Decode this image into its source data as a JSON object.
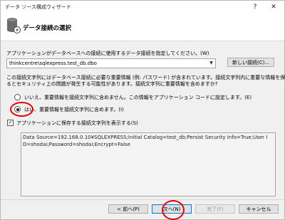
{
  "window": {
    "title": "データ ソース構成ウィザード",
    "help_label": "?",
    "close_label": "✕"
  },
  "header": {
    "title": "データ接続の選択"
  },
  "connection": {
    "prompt": "アプリケーションがデータベースへの接続に使用するデータ接続を指定してください。(W)",
    "selected": "thinkcentre\\sqlexpress.test_db.dbo",
    "new_connection_label": "新しい接続(C)..."
  },
  "sensitive_info": {
    "description_line1": "この接続文字列にはデータベース接続に必要な重要情報 (例: パスワード) が含まれています。接続文字列内に重要な情報を保存す",
    "description_line2": "るとセキュリティ上の問題が発生する可能性があります。接続文字列に重要情報を含めますか?",
    "option_exclude": "いいえ、重要情報を接続文字列に含めません。この情報をアプリケーション コードに設定します。(E)",
    "option_include": "はい、重要情報を接続文字列に含めます。(I)"
  },
  "show_connection_string": {
    "label": "アプリケーションに保存する接続文字列を表示する(S)",
    "checked": true,
    "value": "Data Source=192.168.0.10¥SQLEXPRESS;Initial Catalog=test_db;Persist Security Info=True;User ID=shodai;Password=shodai;Encrypt=False"
  },
  "footer": {
    "back_label": "< 前へ(P)",
    "next_label": "次へ(N)",
    "finish_label": "完了(F)",
    "cancel_label": "キャンセル"
  },
  "colors": {
    "highlight_circle": "#e00000",
    "default_button_border": "#0078d7"
  }
}
